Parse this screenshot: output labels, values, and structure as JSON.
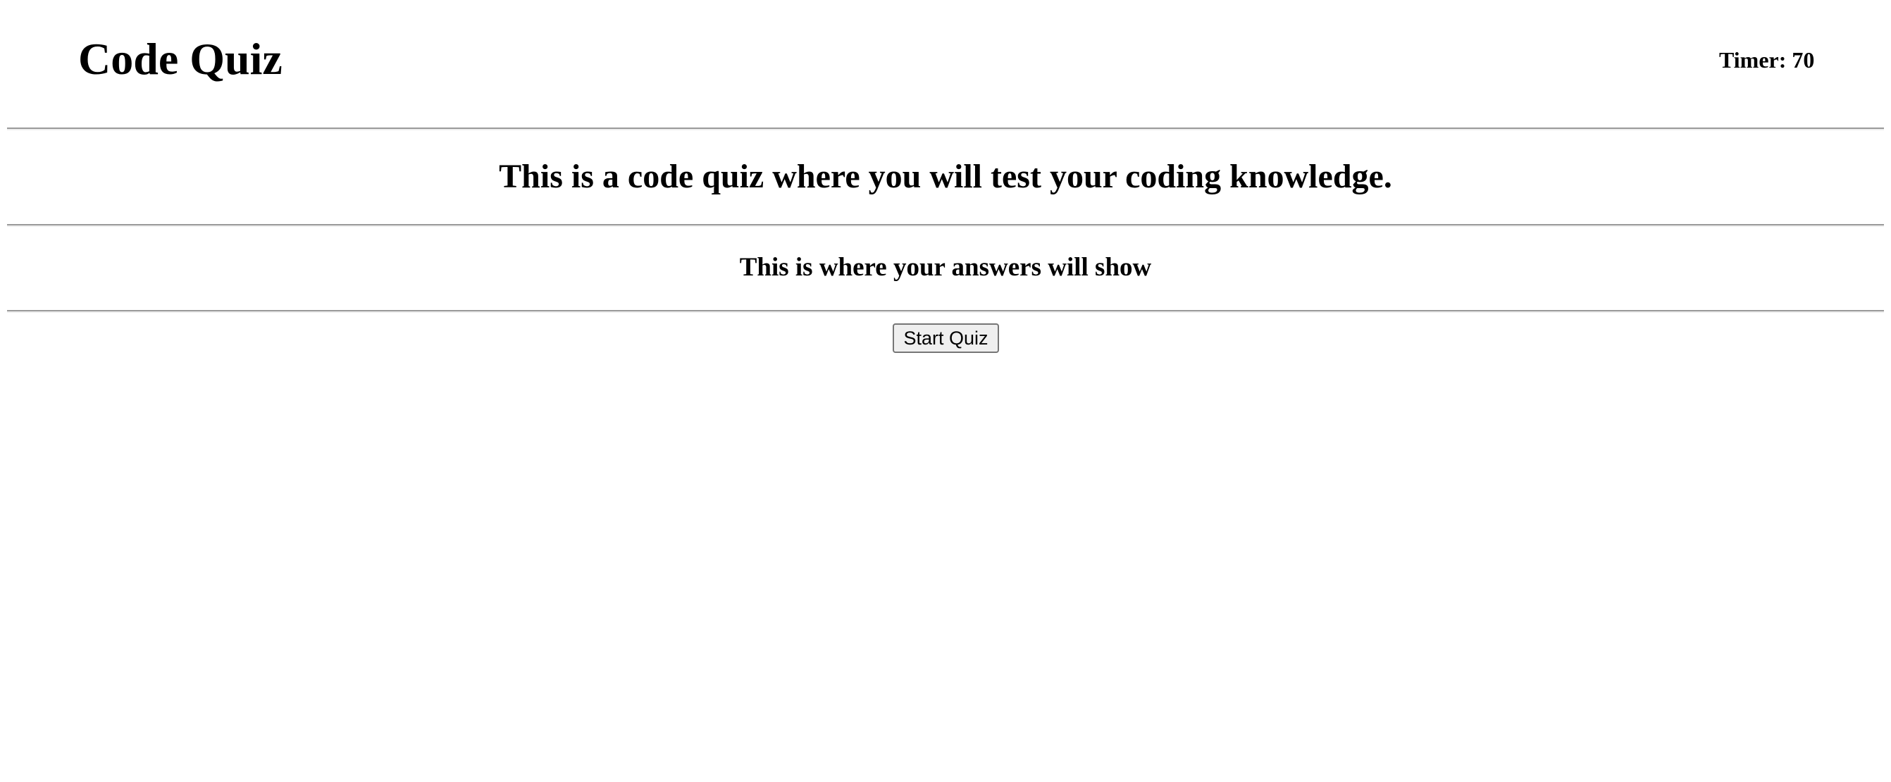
{
  "header": {
    "title": "Code Quiz",
    "timer_label": "Timer: 70"
  },
  "main": {
    "intro": "This is a code quiz where you will test your coding knowledge.",
    "answers_placeholder": "This is where your answers will show",
    "start_button": "Start Quiz"
  }
}
